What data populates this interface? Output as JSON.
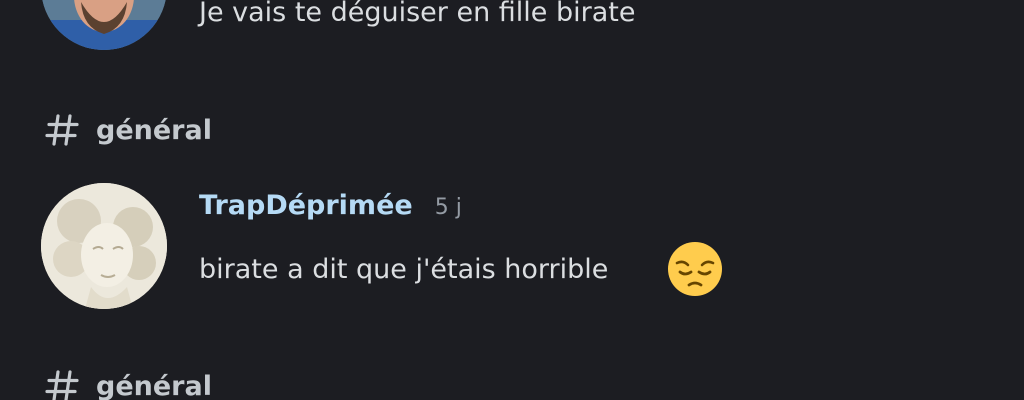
{
  "messages": [
    {
      "text": "Je vais te déguiser en fille birate",
      "avatar_icon": "man-portrait-avatar"
    },
    {
      "channel": "général",
      "author": "TrapDéprimée",
      "timestamp": "5 j",
      "text": "birate a dit que j'étais horrible",
      "emoji": "pensive-face-icon",
      "avatar_icon": "marble-statue-face-avatar",
      "author_color": "#b5daf5"
    }
  ],
  "next_channel": "général",
  "colors": {
    "background": "#1c1d22",
    "text": "#dbdee1",
    "muted": "#949ba4",
    "channel": "#c4c9ce"
  }
}
